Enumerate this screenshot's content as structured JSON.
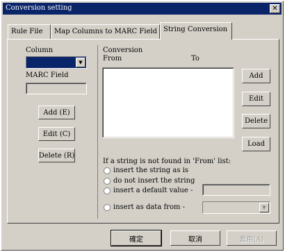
{
  "window": {
    "title": "Conversion setting"
  },
  "tabs": [
    {
      "label": "Rule File"
    },
    {
      "label": "Map Columns to MARC Field"
    },
    {
      "label": "String Conversion"
    }
  ],
  "left_panel": {
    "column_label": "Column",
    "column_value": "",
    "marc_field_label": "MARC Field",
    "marc_field_value": "",
    "add_label": "Add (E)",
    "edit_label": "Edit (C)",
    "delete_label": "Delete (R)"
  },
  "conversion": {
    "group_label": "Conversion",
    "from_header": "From",
    "to_header": "To",
    "rows": [],
    "add_label": "Add",
    "edit_label": "Edit",
    "delete_label": "Delete",
    "load_label": "Load"
  },
  "not_found": {
    "prompt": "If a string is not found in 'From' list:",
    "option_insert_as_is": "insert the string as is",
    "option_do_not_insert": "do not insert the string",
    "option_insert_default": "insert a default value -",
    "option_insert_data_from": "insert as data from -",
    "default_value": "",
    "data_from_value": ""
  },
  "footer": {
    "ok_label": "確定",
    "cancel_label": "取消",
    "apply_label": "套用(A)"
  },
  "colors": {
    "title_bar": "#0a246a",
    "dialog_face": "#d4d0c8",
    "column_selected": "#0a246a"
  }
}
